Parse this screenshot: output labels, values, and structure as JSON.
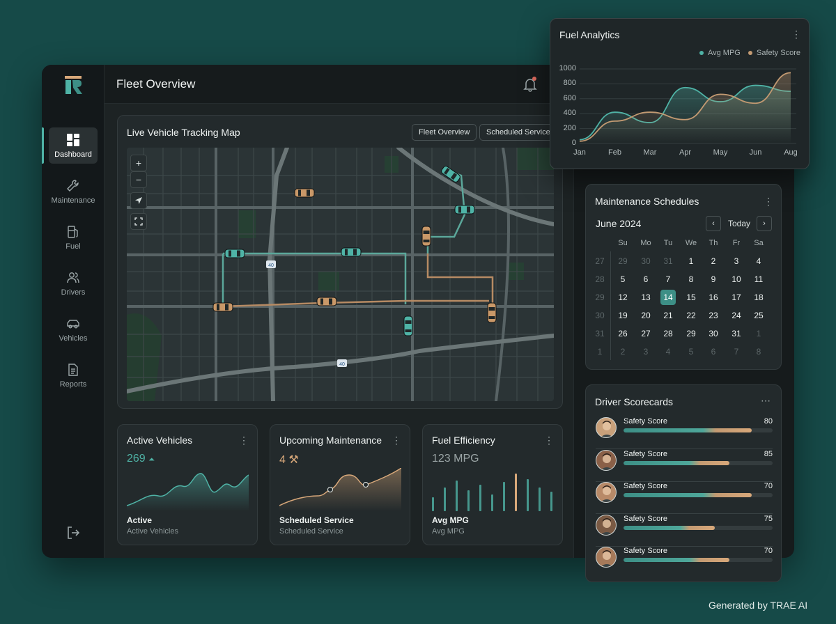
{
  "nav": {
    "items": [
      {
        "label": "Dashboard",
        "icon": "dashboard-icon",
        "active": true
      },
      {
        "label": "Maintenance",
        "icon": "wrench-icon"
      },
      {
        "label": "Fuel",
        "icon": "fuel-pump-icon"
      },
      {
        "label": "Drivers",
        "icon": "users-icon"
      },
      {
        "label": "Vehicles",
        "icon": "car-icon"
      },
      {
        "label": "Reports",
        "icon": "document-icon"
      }
    ]
  },
  "header": {
    "title": "Fleet Overview"
  },
  "map_card": {
    "title": "Live Vehicle Tracking Map",
    "buttons": [
      "Fleet Overview",
      "Scheduled Service"
    ],
    "controls": {
      "zoom_in": "+",
      "zoom_out": "−"
    },
    "highway_shields": [
      "40",
      "40"
    ]
  },
  "stats": [
    {
      "title": "Active Vehicles",
      "value": "269",
      "label": "Active",
      "sub": "Active Vehicles",
      "color": "#4fb3a6"
    },
    {
      "title": "Upcoming Maintenance",
      "value": "4",
      "label": "Scheduled Service",
      "sub": "Scheduled Service",
      "color": "#d8a87a"
    },
    {
      "title": "Fuel Efficiency",
      "value": "123 MPG",
      "label": "Avg MPG",
      "sub": "Avg MPG",
      "color": "#9aa4a5"
    }
  ],
  "fuel_analytics": {
    "title": "Fuel Analytics",
    "legend": [
      {
        "name": "Avg MPG",
        "color": "#4fb3a6"
      },
      {
        "name": "Safety Score",
        "color": "#c39a72"
      }
    ]
  },
  "chart_data": {
    "type": "area",
    "categories": [
      "Jan",
      "Feb",
      "Mar",
      "Apr",
      "May",
      "Jun",
      "Aug"
    ],
    "series": [
      {
        "name": "Avg MPG",
        "values": [
          50,
          420,
          280,
          750,
          560,
          780,
          700
        ]
      },
      {
        "name": "Safety Score",
        "values": [
          30,
          300,
          420,
          320,
          660,
          540,
          950
        ]
      }
    ],
    "yticks": [
      0,
      200,
      400,
      600,
      800,
      1000
    ],
    "ylim": [
      0,
      1000
    ],
    "legend": "top-right"
  },
  "calendar": {
    "title": "Maintenance Schedules",
    "month": "June 2024",
    "today_label": "Today",
    "prev": "‹",
    "next": "›",
    "weekdays": [
      "Su",
      "Mo",
      "Tu",
      "We",
      "Th",
      "Fr",
      "Sa"
    ],
    "weeks": [
      {
        "wk": "27",
        "days": [
          "29",
          "30",
          "31",
          "1",
          "2",
          "3",
          "4"
        ]
      },
      {
        "wk": "28",
        "days": [
          "5",
          "6",
          "7",
          "8",
          "9",
          "10",
          "11"
        ]
      },
      {
        "wk": "29",
        "days": [
          "12",
          "13",
          "14",
          "15",
          "16",
          "17",
          "18"
        ]
      },
      {
        "wk": "30",
        "days": [
          "19",
          "20",
          "21",
          "22",
          "23",
          "24",
          "25"
        ]
      },
      {
        "wk": "31",
        "days": [
          "26",
          "27",
          "28",
          "29",
          "30",
          "31",
          "1"
        ]
      },
      {
        "wk": "1",
        "days": [
          "2",
          "3",
          "4",
          "5",
          "6",
          "7",
          "8"
        ]
      }
    ],
    "selected": "14"
  },
  "drivers": {
    "title": "Driver Scorecards",
    "rows": [
      {
        "label": "Safety Score",
        "score": "80",
        "progress": 0.86
      },
      {
        "label": "Safety Score",
        "score": "85",
        "progress": 0.71
      },
      {
        "label": "Safety Score",
        "score": "70",
        "progress": 0.86
      },
      {
        "label": "Safety Score",
        "score": "75",
        "progress": 0.61
      },
      {
        "label": "Safety Score",
        "score": "70",
        "progress": 0.71
      }
    ]
  },
  "watermark": "Generated by TRAE AI"
}
